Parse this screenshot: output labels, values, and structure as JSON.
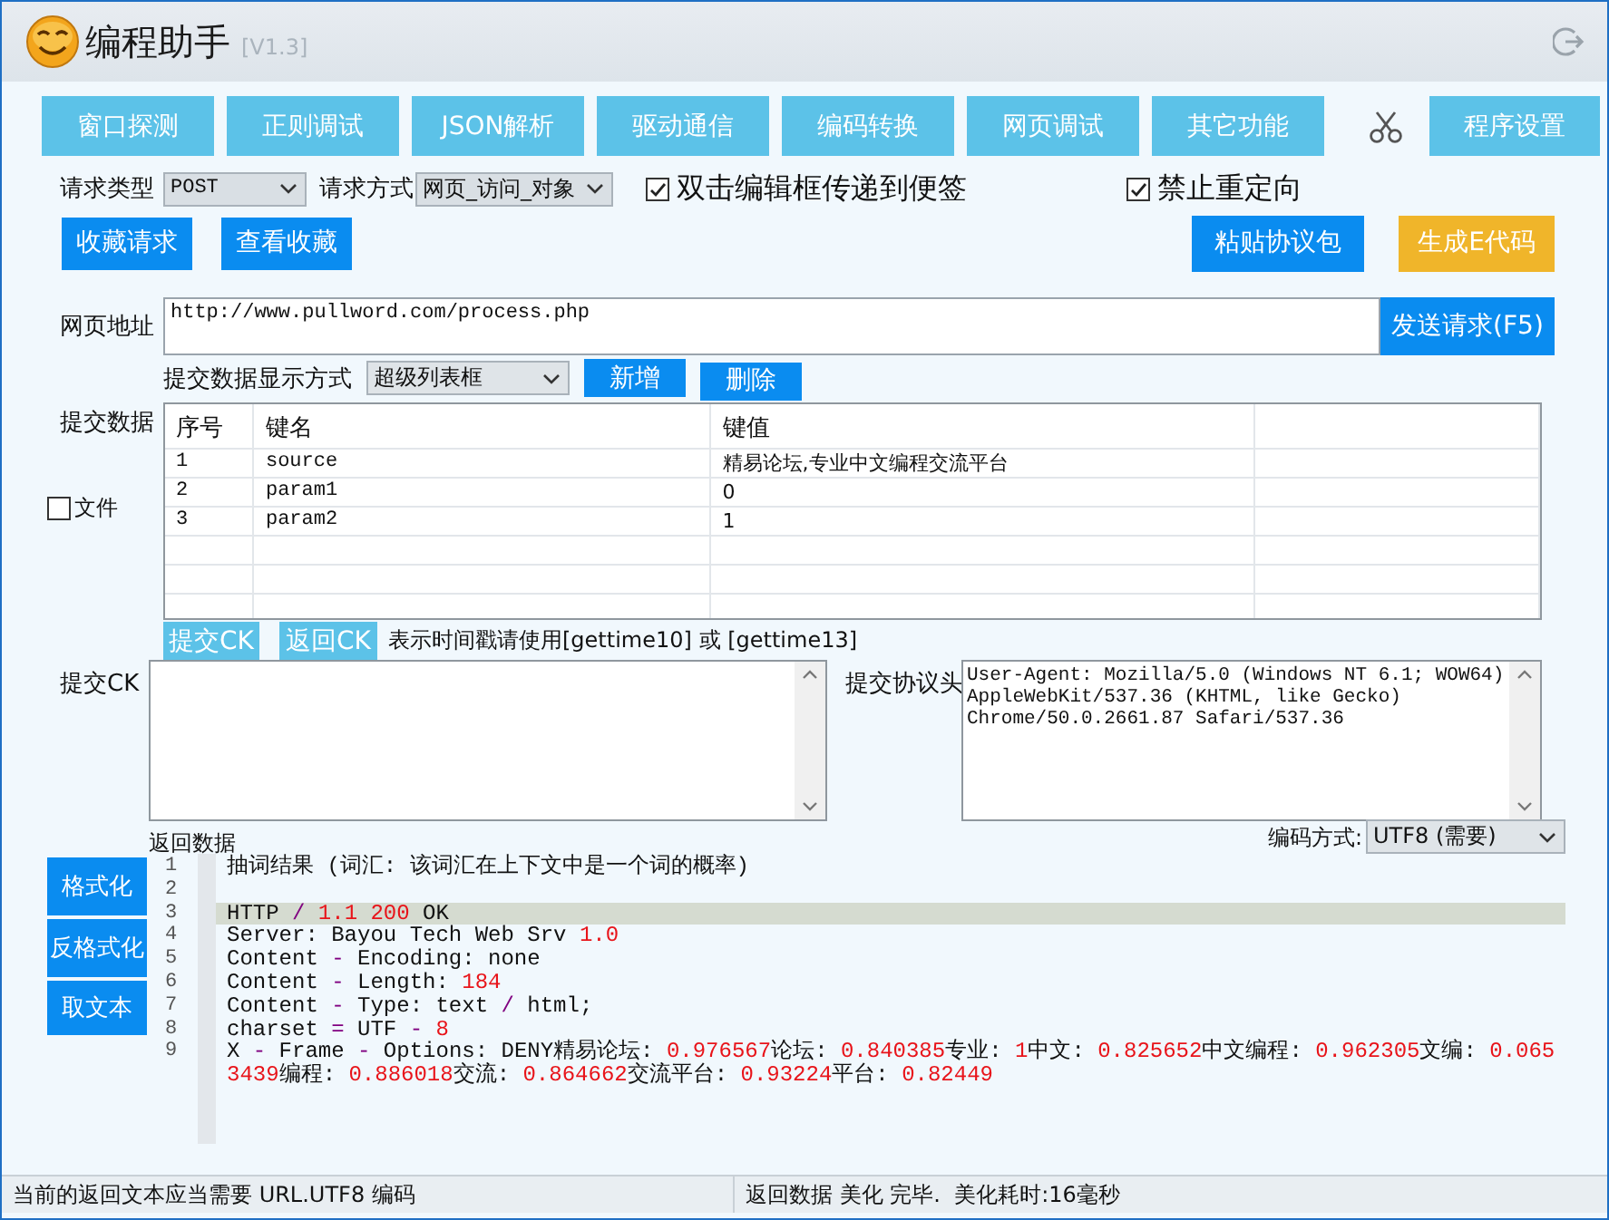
{
  "window": {
    "title": "编程助手",
    "version": "[V1.3]"
  },
  "tabs": [
    {
      "label": "窗口探测",
      "selected": false
    },
    {
      "label": "正则调试",
      "selected": false
    },
    {
      "label": "JSON解析",
      "selected": false
    },
    {
      "label": "驱动通信",
      "selected": false
    },
    {
      "label": "编码转换",
      "selected": false
    },
    {
      "label": "网页调试",
      "selected": false
    },
    {
      "label": "其它功能",
      "selected": false
    }
  ],
  "settings_button": "程序设置",
  "request": {
    "type_label": "请求类型",
    "type_value": "POST",
    "method_label": "请求方式",
    "method_value": "网页_访问_对象",
    "options": [
      {
        "label": "双击编辑框传递到便签",
        "checked": true
      },
      {
        "label": "禁止重定向",
        "checked": true
      }
    ]
  },
  "buttons": {
    "favorite": "收藏请求",
    "view_favorites": "查看收藏",
    "paste": "粘贴协议包",
    "generate": "生成E代码"
  },
  "url": {
    "label": "网页地址",
    "value": "http://www.pullword.com/process.php",
    "send": "发送请求(F5)"
  },
  "submit": {
    "mode_label": "提交数据显示方式",
    "mode_value": "超级列表框",
    "add": "新增",
    "delete": "删除",
    "label": "提交数据",
    "file": {
      "label": "文件",
      "checked": false
    }
  },
  "table": {
    "columns": [
      "序号",
      "键名",
      "键值"
    ],
    "rows": [
      [
        "1",
        "source",
        "精易论坛,专业中文编程交流平台"
      ],
      [
        "2",
        "param1",
        "0"
      ],
      [
        "3",
        "param2",
        "1"
      ]
    ]
  },
  "cookie_buttons": [
    "提交CK",
    "返回CK"
  ],
  "hint": "表示时间戳请使用[gettime10] 或 [gettime13]",
  "cookie": {
    "label": "提交CK"
  },
  "headers": {
    "label": "提交协议头",
    "value": "User-Agent: Mozilla/5.0 (Windows NT 6.1; WOW64)\nAppleWebKit/537.36 (KHTML, like Gecko)\nChrome/50.0.2661.87 Safari/537.36"
  },
  "response": {
    "label": "返回数据",
    "encoding_label": "编码方式:",
    "encoding_value": "UTF8 (需要)",
    "side_buttons": [
      "格式化",
      "反格式化",
      "取文本"
    ],
    "lines": [
      {
        "number": "1",
        "selected": false,
        "segments": [
          {
            "text": "抽词结果 (词汇: 该词汇在上下文中是一个词的概率)",
            "kind": "plain"
          }
        ]
      },
      {
        "number": "2",
        "selected": false
      },
      {
        "number": "3",
        "selected": true,
        "segments": [
          {
            "text": "HTTP ",
            "kind": "plain"
          },
          {
            "text": "/",
            "kind": "op"
          },
          {
            "text": " 1.1 200",
            "kind": "num"
          },
          {
            "text": " OK",
            "kind": "plain"
          }
        ]
      },
      {
        "number": "4",
        "selected": false,
        "segments": [
          {
            "text": "Server: Bayou Tech Web Srv ",
            "kind": "plain"
          },
          {
            "text": "1.0",
            "kind": "num"
          }
        ]
      },
      {
        "number": "5",
        "selected": false,
        "segments": [
          {
            "text": "Content ",
            "kind": "plain"
          },
          {
            "text": "-",
            "kind": "op"
          },
          {
            "text": " Encoding: none",
            "kind": "plain"
          }
        ]
      },
      {
        "number": "6",
        "selected": false,
        "segments": [
          {
            "text": "Content ",
            "kind": "plain"
          },
          {
            "text": "-",
            "kind": "op"
          },
          {
            "text": " Length: ",
            "kind": "plain"
          },
          {
            "text": "184",
            "kind": "num"
          }
        ]
      },
      {
        "number": "7",
        "selected": false,
        "segments": [
          {
            "text": "Content ",
            "kind": "plain"
          },
          {
            "text": "-",
            "kind": "op"
          },
          {
            "text": " Type: text ",
            "kind": "plain"
          },
          {
            "text": "/",
            "kind": "op"
          },
          {
            "text": " html;",
            "kind": "plain"
          }
        ]
      },
      {
        "number": "8",
        "selected": false,
        "segments": [
          {
            "text": "charset ",
            "kind": "plain"
          },
          {
            "text": "=",
            "kind": "op"
          },
          {
            "text": " UTF ",
            "kind": "plain"
          },
          {
            "text": "-",
            "kind": "op"
          },
          {
            "text": " 8",
            "kind": "num"
          }
        ]
      },
      {
        "number": "9",
        "selected": false,
        "segments": [
          {
            "text": "X ",
            "kind": "plain"
          },
          {
            "text": "-",
            "kind": "op"
          },
          {
            "text": " Frame ",
            "kind": "plain"
          },
          {
            "text": "-",
            "kind": "op"
          },
          {
            "text": " Options: DENY精易论坛: ",
            "kind": "plain"
          },
          {
            "text": "0.976567",
            "kind": "num"
          },
          {
            "text": "论坛: ",
            "kind": "plain"
          },
          {
            "text": "0.840385",
            "kind": "num"
          },
          {
            "text": "专业: ",
            "kind": "plain"
          },
          {
            "text": "1",
            "kind": "num"
          },
          {
            "text": "中文: ",
            "kind": "plain"
          },
          {
            "text": "0.825652",
            "kind": "num"
          },
          {
            "text": "中文编程: ",
            "kind": "plain"
          },
          {
            "text": "0.962305",
            "kind": "num"
          },
          {
            "text": "文编: ",
            "kind": "plain"
          },
          {
            "text": "0.0653439",
            "kind": "num"
          },
          {
            "text": "编程: ",
            "kind": "plain"
          },
          {
            "text": "0.886018",
            "kind": "num"
          },
          {
            "text": "交流: ",
            "kind": "plain"
          },
          {
            "text": "0.864662",
            "kind": "num"
          },
          {
            "text": "交流平台: ",
            "kind": "plain"
          },
          {
            "text": "0.93224",
            "kind": "num"
          },
          {
            "text": "平台: ",
            "kind": "plain"
          },
          {
            "text": "0.82449",
            "kind": "num"
          }
        ]
      }
    ]
  },
  "status_bar": [
    "当前的返回文本应当需要 URL.UTF8 编码",
    "返回数据 美化 完毕.  美化耗时:16毫秒"
  ]
}
